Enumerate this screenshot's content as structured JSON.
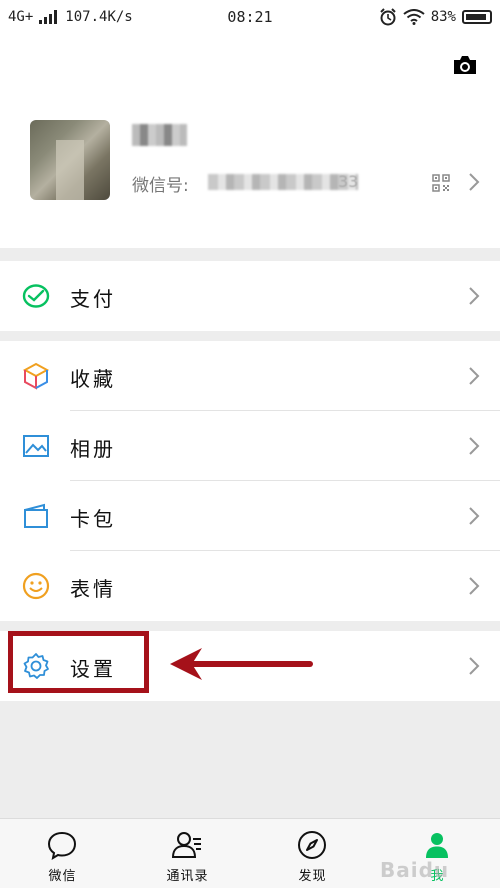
{
  "status_bar": {
    "network": "4G+",
    "speed": "107.4K/s",
    "time": "08:21",
    "battery": "83%"
  },
  "profile": {
    "wechat_id_label": "微信号:",
    "wechat_id_suffix": "33"
  },
  "menu": {
    "pay": "支付",
    "favorites": "收藏",
    "album": "相册",
    "cards": "卡包",
    "stickers": "表情",
    "settings": "设置"
  },
  "tabs": [
    {
      "label": "微信"
    },
    {
      "label": "通讯录"
    },
    {
      "label": "发现"
    },
    {
      "label": "我"
    }
  ],
  "watermark": "Baidu",
  "colors": {
    "accent": "#07c160",
    "annotation": "#a5111a"
  }
}
